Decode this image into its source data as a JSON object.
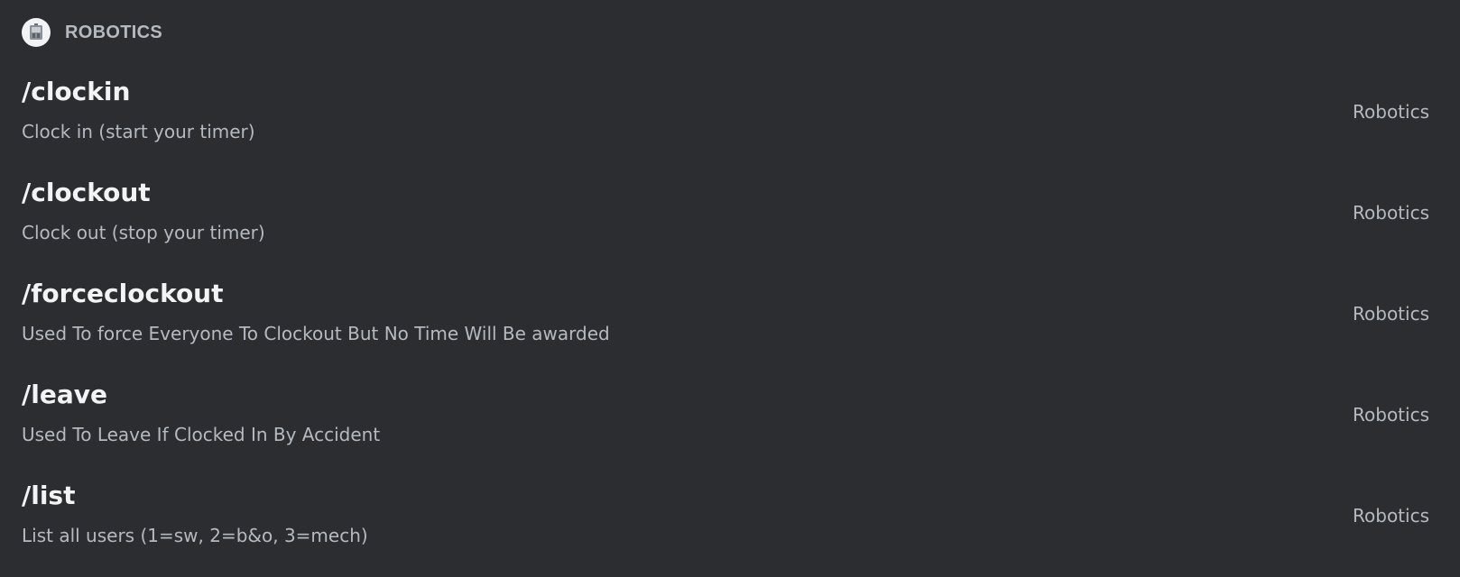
{
  "section": {
    "title": "ROBOTICS",
    "icon": "robot-app-icon"
  },
  "commands": [
    {
      "name": "/clockin",
      "description": "Clock in (start your timer)",
      "source": "Robotics"
    },
    {
      "name": "/clockout",
      "description": "Clock out (stop your timer)",
      "source": "Robotics"
    },
    {
      "name": "/forceclockout",
      "description": "Used To force Everyone To Clockout But No Time Will Be awarded",
      "source": "Robotics"
    },
    {
      "name": "/leave",
      "description": "Used To Leave If Clocked In By Accident",
      "source": "Robotics"
    },
    {
      "name": "/list",
      "description": "List all users (1=sw, 2=b&o, 3=mech)",
      "source": "Robotics"
    }
  ],
  "colors": {
    "background": "#2b2d31",
    "command_name": "#f2f3f5",
    "muted_text": "#b5bac1"
  }
}
